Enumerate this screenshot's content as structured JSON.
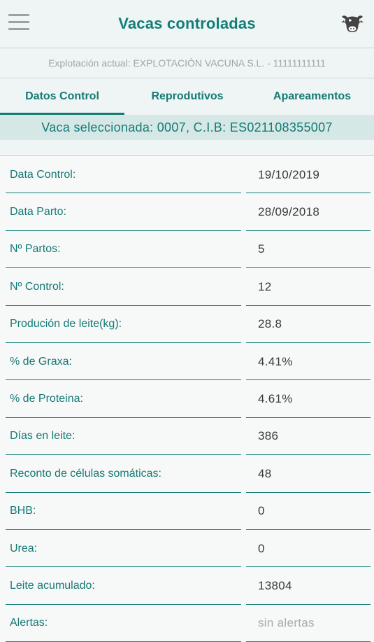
{
  "header": {
    "title": "Vacas controladas",
    "menu_icon": "hamburger-menu-icon",
    "cow_icon": "cow-head-icon"
  },
  "farm_info": "Explotación actual: EXPLOTACIÓN VACUNA S.L. - 11111111111",
  "tabs": [
    {
      "label": "Datos Control",
      "active": true
    },
    {
      "label": "Reprodutivos",
      "active": false
    },
    {
      "label": "Apareamentos",
      "active": false
    }
  ],
  "selected_cow": "Vaca seleccionada: 0007, C.I.B: ES021108355007",
  "rows": [
    {
      "label": "Data Control:",
      "value": "19/10/2019"
    },
    {
      "label": "Data Parto:",
      "value": "28/09/2018"
    },
    {
      "label": "Nº Partos:",
      "value": "5"
    },
    {
      "label": "Nº Control:",
      "value": "12"
    },
    {
      "label": "Produción de leite(kg):",
      "value": "28.8"
    },
    {
      "label": "% de Graxa:",
      "value": "4.41%"
    },
    {
      "label": "% de Proteina:",
      "value": "4.61%"
    },
    {
      "label": "Días en leite:",
      "value": "386"
    },
    {
      "label": "Reconto de células somáticas:",
      "value": "48"
    },
    {
      "label": "BHB:",
      "value": "0"
    },
    {
      "label": "Urea:",
      "value": "0"
    },
    {
      "label": "Leite acumulado:",
      "value": "13804"
    },
    {
      "label": "Alertas:",
      "value": "sin alertas"
    }
  ],
  "colors": {
    "accent": "#147a75",
    "background": "#eef5f4",
    "selected_bar": "#d6e8e6",
    "muted_text": "#9ea7a7"
  }
}
